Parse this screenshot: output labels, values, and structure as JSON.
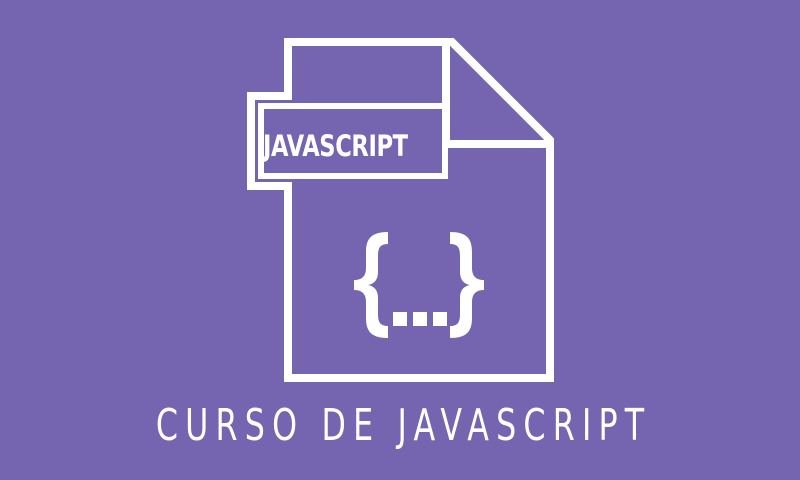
{
  "file_icon": {
    "label": "JAVASCRIPT",
    "icon_name": "javascript-file-icon",
    "braces_icon": "curly-braces-ellipsis-icon"
  },
  "caption": "CURSO DE JAVASCRIPT",
  "colors": {
    "background": "#7565b0",
    "foreground": "#ffffff"
  }
}
